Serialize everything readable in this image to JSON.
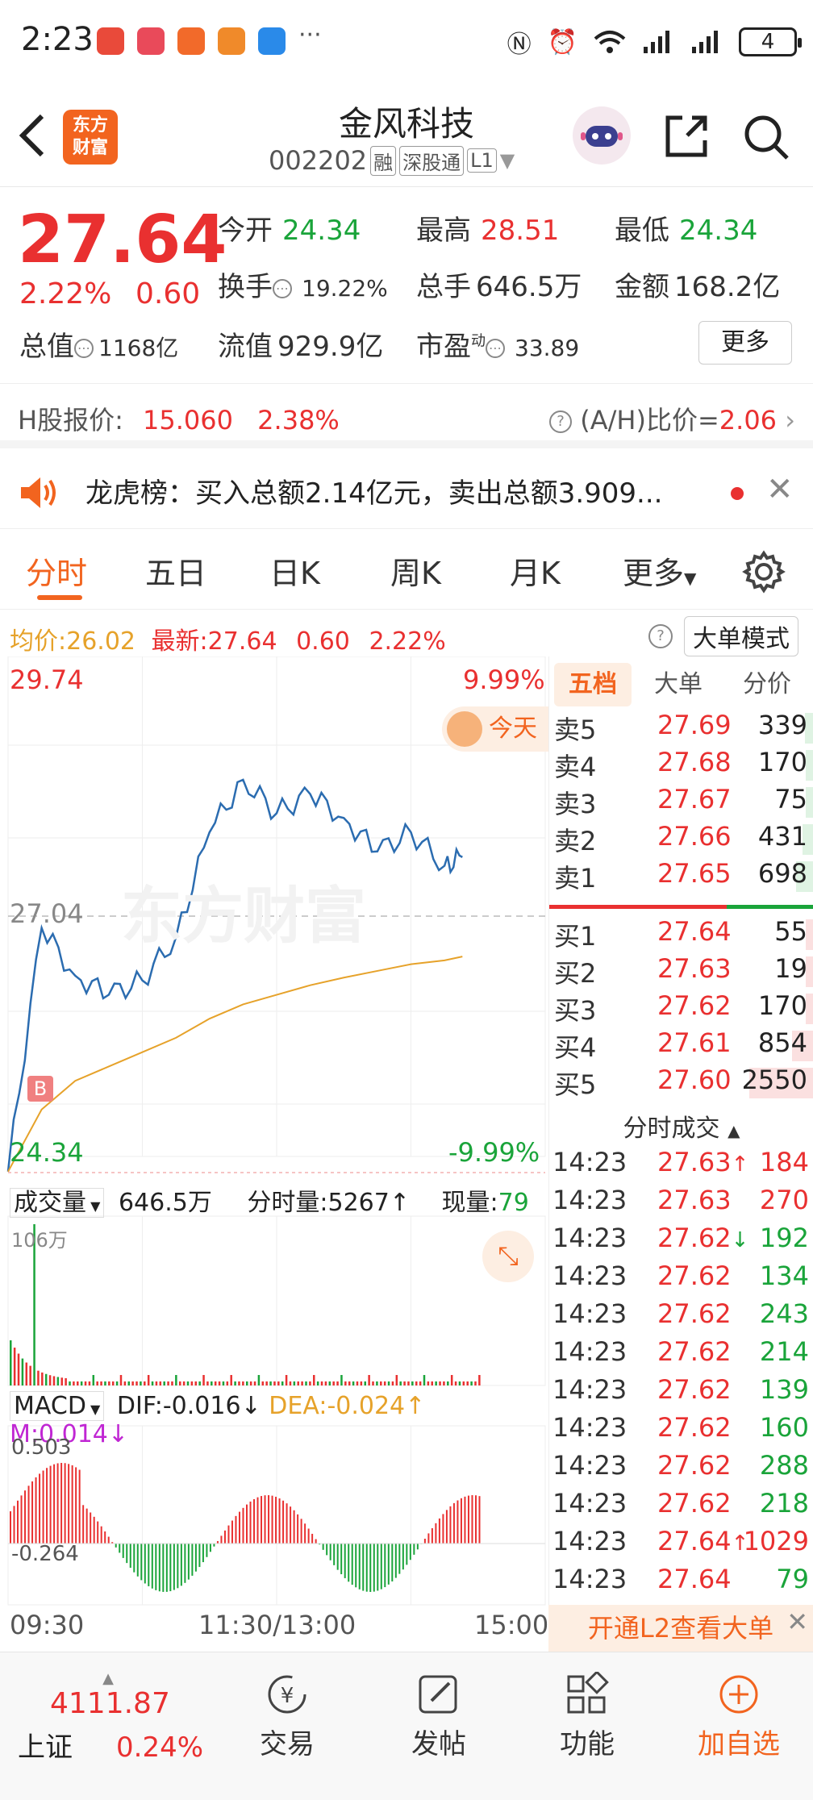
{
  "status_bar": {
    "time": "2:23",
    "more": "···",
    "battery": "4"
  },
  "header": {
    "title": "金风科技",
    "code": "002202",
    "tags": [
      "融",
      "深股通",
      "L1"
    ],
    "logo_text": "东方\n财富"
  },
  "quote": {
    "price": "27.64",
    "pct": "2.22%",
    "change": "0.60",
    "open_label": "今开",
    "open": "24.34",
    "high_label": "最高",
    "high": "28.51",
    "low_label": "最低",
    "low": "24.34",
    "turnover_label": "换手",
    "turnover": "19.22%",
    "volume_label": "总手",
    "volume": "646.5万",
    "amount_label": "金额",
    "amount": "168.2亿",
    "mktcap_label": "总值",
    "mktcap": "1168亿",
    "float_label": "流值",
    "float": "929.9亿",
    "pe_label": "市盈",
    "pe_sup": "动",
    "pe": "33.89",
    "more_label": "更多"
  },
  "hshare": {
    "label": "H股报价:",
    "price": "15.060",
    "pct": "2.38%",
    "ratio_label": "(A/H)比价=",
    "ratio": "2.06"
  },
  "announcement": {
    "text": "龙虎榜：买入总额2.14亿元，卖出总额3.909..."
  },
  "tabs": [
    "分时",
    "五日",
    "日K",
    "周K",
    "月K",
    "更多"
  ],
  "avg_line": {
    "avg_label": "均价:",
    "avg": "26.02",
    "latest_label": "最新:",
    "latest": "27.64",
    "change": "0.60",
    "pct": "2.22%",
    "mode_button": "大单模式"
  },
  "chart": {
    "y_top": "29.74",
    "y_mid": "27.04",
    "y_bottom": "24.34",
    "pct_top": "9.99%",
    "pct_bottom": "-9.99%",
    "today_badge": "今天",
    "watermark": "东方财富",
    "b_marker": "B",
    "vol_label": "成交量",
    "vol_total": "646.5万",
    "minute_vol_label": "分时量:",
    "minute_vol": "5267",
    "current_label": "现量:",
    "current": "79",
    "vol_axis": "106万",
    "macd_label": "MACD",
    "dif_label": "DIF:",
    "dif": "-0.016",
    "dea_label": "DEA:",
    "dea": "-0.024",
    "m_label": "M:",
    "m": "0.014",
    "macd_top": "0.503",
    "macd_bottom": "-0.264",
    "x_labels": [
      "09:30",
      "11:30/13:00",
      "15:00"
    ]
  },
  "chart_data": {
    "type": "line",
    "title": "",
    "xlabel": "",
    "ylabel": "",
    "ylim": [
      24.34,
      29.74
    ],
    "x": [
      "09:30",
      "09:45",
      "10:00",
      "10:15",
      "10:30",
      "10:45",
      "11:00",
      "11:15",
      "11:30",
      "13:15",
      "13:30",
      "13:45",
      "14:00",
      "14:15",
      "14:23"
    ],
    "series": [
      {
        "values": [
          24.35,
          26.9,
          26.4,
          26.2,
          26.35,
          26.8,
          27.9,
          28.45,
          28.1,
          28.3,
          28.05,
          27.7,
          27.9,
          27.55,
          27.64
        ]
      },
      {
        "values": [
          24.35,
          25.0,
          25.3,
          25.45,
          25.6,
          25.75,
          25.95,
          26.1,
          26.2,
          26.3,
          26.38,
          26.45,
          26.52,
          26.56,
          26.6
        ]
      }
    ],
    "grid": true
  },
  "orderbook": {
    "tabs": [
      "五档",
      "大单",
      "分价"
    ],
    "asks": [
      {
        "label": "卖5",
        "price": "27.69",
        "vol": "339"
      },
      {
        "label": "卖4",
        "price": "27.68",
        "vol": "170"
      },
      {
        "label": "卖3",
        "price": "27.67",
        "vol": "75"
      },
      {
        "label": "卖2",
        "price": "27.66",
        "vol": "431"
      },
      {
        "label": "卖1",
        "price": "27.65",
        "vol": "698"
      }
    ],
    "bids": [
      {
        "label": "买1",
        "price": "27.64",
        "vol": "55"
      },
      {
        "label": "买2",
        "price": "27.63",
        "vol": "19"
      },
      {
        "label": "买3",
        "price": "27.62",
        "vol": "170"
      },
      {
        "label": "买4",
        "price": "27.61",
        "vol": "854"
      },
      {
        "label": "买5",
        "price": "27.60",
        "vol": "2550"
      }
    ],
    "trades_title": "分时成交",
    "trades": [
      {
        "time": "14:23",
        "price": "27.63",
        "arrow": "↑",
        "vol": "184",
        "c": "red"
      },
      {
        "time": "14:23",
        "price": "27.63",
        "arrow": "",
        "vol": "270",
        "c": "red"
      },
      {
        "time": "14:23",
        "price": "27.62",
        "arrow": "↓",
        "vol": "192",
        "c": "green"
      },
      {
        "time": "14:23",
        "price": "27.62",
        "arrow": "",
        "vol": "134",
        "c": "green"
      },
      {
        "time": "14:23",
        "price": "27.62",
        "arrow": "",
        "vol": "243",
        "c": "green"
      },
      {
        "time": "14:23",
        "price": "27.62",
        "arrow": "",
        "vol": "214",
        "c": "green"
      },
      {
        "time": "14:23",
        "price": "27.62",
        "arrow": "",
        "vol": "139",
        "c": "green"
      },
      {
        "time": "14:23",
        "price": "27.62",
        "arrow": "",
        "vol": "160",
        "c": "green"
      },
      {
        "time": "14:23",
        "price": "27.62",
        "arrow": "",
        "vol": "288",
        "c": "green"
      },
      {
        "time": "14:23",
        "price": "27.62",
        "arrow": "",
        "vol": "218",
        "c": "green"
      },
      {
        "time": "14:23",
        "price": "27.64",
        "arrow": "↑",
        "vol": "1029",
        "c": "red"
      },
      {
        "time": "14:23",
        "price": "27.64",
        "arrow": "",
        "vol": "79",
        "c": "green"
      }
    ],
    "l2_banner": "开通L2查看大单"
  },
  "bottom": {
    "index_value": "4111.87",
    "index_name": "上证",
    "index_pct": "0.24%",
    "trade": "交易",
    "post": "发帖",
    "func": "功能",
    "add": "加自选"
  },
  "colors": {
    "up": "#e93030",
    "down": "#1aa43a",
    "accent": "#f2641f",
    "price_line": "#2b6cb0",
    "avg_line": "#e6a22a"
  }
}
